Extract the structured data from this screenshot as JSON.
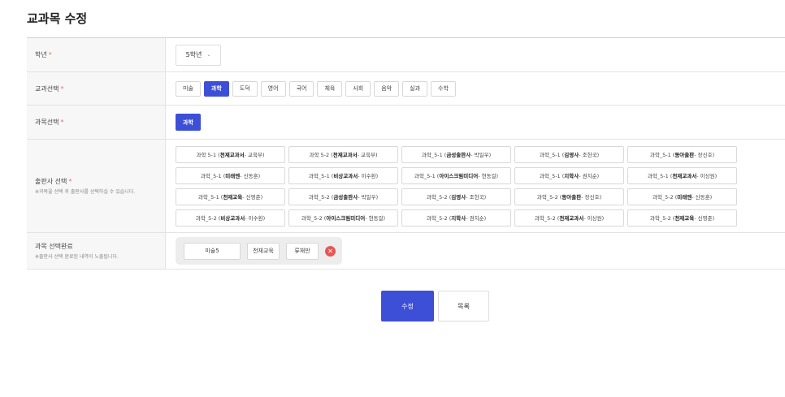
{
  "page": {
    "title": "교과목 수정"
  },
  "fields": {
    "grade": {
      "label": "학년",
      "required": "*",
      "value": "5학년",
      "chevron": "⌄"
    },
    "subject": {
      "label": "교과선택",
      "required": "*",
      "options": [
        "미술",
        "과학",
        "도덕",
        "영어",
        "국어",
        "체육",
        "사회",
        "음악",
        "실과",
        "수학"
      ],
      "selected": "과학"
    },
    "course": {
      "label": "과목선택",
      "required": "*",
      "value": "과학"
    },
    "publisher": {
      "label": "출판사 선택",
      "required": "*",
      "hint": "※과목을 선택 후 출판사를 선택하실 수 있습니다.",
      "items": [
        {
          "pre": "과학 5-1 (",
          "name": "천재교과서",
          "post": " - 교육부)"
        },
        {
          "pre": "과학 5-2 (",
          "name": "천재교과서",
          "post": " - 교육부)"
        },
        {
          "pre": "과학_5-1 (",
          "name": "금성출판사",
          "post": " - 박일우)"
        },
        {
          "pre": "과학_5-1 (",
          "name": "김영사",
          "post": " - 조헌국)"
        },
        {
          "pre": "과학_5-1 (",
          "name": "동아출판",
          "post": " - 장신호)"
        },
        {
          "pre": "과학_5-1 (",
          "name": "미래엔",
          "post": " - 신동훈)"
        },
        {
          "pre": "과학_5-1 (",
          "name": "비상교과서",
          "post": " - 이수환)"
        },
        {
          "pre": "과학_5-1 (",
          "name": "아이스크림미디어",
          "post": " - 현동걸)"
        },
        {
          "pre": "과학_5-1 (",
          "name": "지학사",
          "post": " - 권치순)"
        },
        {
          "pre": "과학_5-1 (",
          "name": "천재교과서",
          "post": " - 이상원)"
        },
        {
          "pre": "과학_5-1 (",
          "name": "천재교육",
          "post": " - 신영준)"
        },
        {
          "pre": "과학_5-2 (",
          "name": "금성출판사",
          "post": " - 박일우)"
        },
        {
          "pre": "과학_5-2 (",
          "name": "김영사",
          "post": " - 조헌국)"
        },
        {
          "pre": "과학_5-2 (",
          "name": "동아출판",
          "post": " - 장신호)"
        },
        {
          "pre": "과학_5-2 (",
          "name": "미래엔",
          "post": " - 신동훈)"
        },
        {
          "pre": "과학_5-2 (",
          "name": "비상교과서",
          "post": " - 이수환)"
        },
        {
          "pre": "과학_5-2 (",
          "name": "아이스크림미디어",
          "post": " - 현동걸)"
        },
        {
          "pre": "과학_5-2 (",
          "name": "지학사",
          "post": " - 권치순)"
        },
        {
          "pre": "과학_5-2 (",
          "name": "천재교과서",
          "post": " - 이상원)"
        },
        {
          "pre": "과학_5-2 (",
          "name": "천재교육",
          "post": " - 신영준)"
        }
      ]
    },
    "completed": {
      "label": "과목 선택완료",
      "hint": "※출판사 선택 완료된 내역이 노출됩니다.",
      "tags": [
        "미술5",
        "천재교육",
        "류재만"
      ],
      "remove": "✕"
    }
  },
  "actions": {
    "submit": "수정",
    "list": "목록"
  },
  "colors": {
    "accent": "#3d4fd6",
    "remove": "#e55757",
    "required": "#ef6b6b"
  }
}
